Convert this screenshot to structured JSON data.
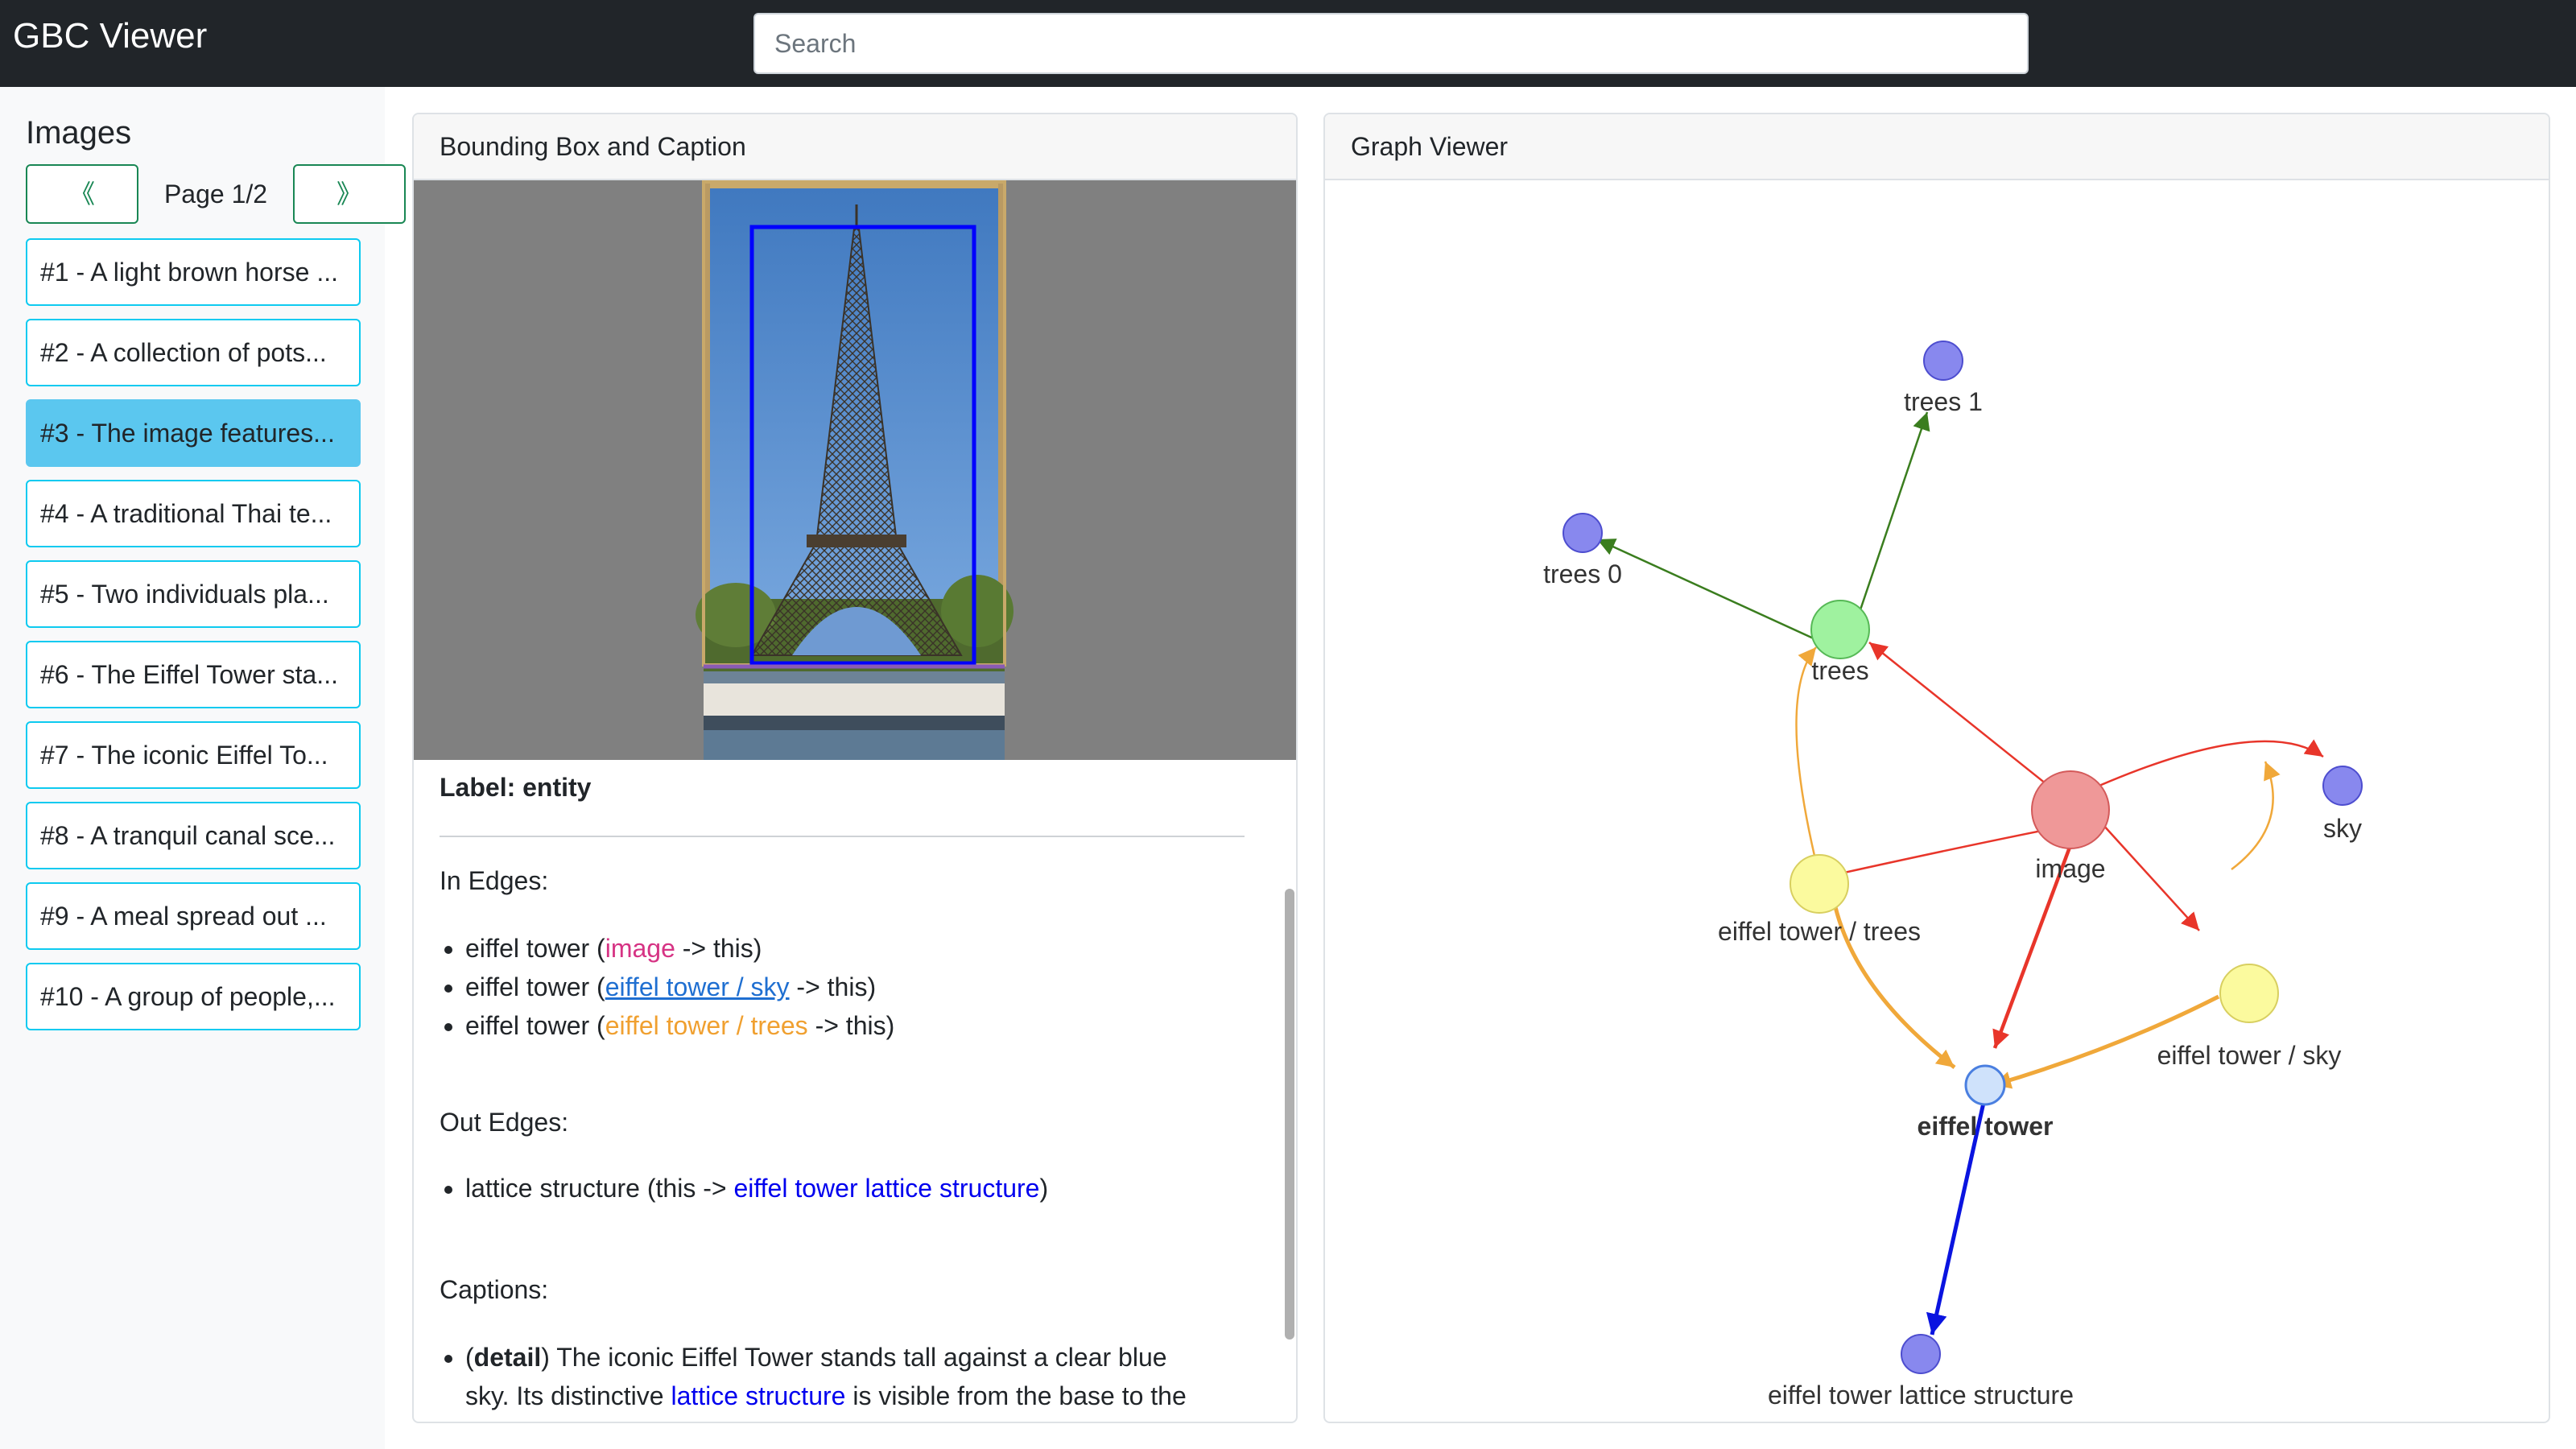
{
  "app": {
    "title": "GBC Viewer"
  },
  "search": {
    "placeholder": "Search"
  },
  "sidebar": {
    "title": "Images",
    "prev_label": "《",
    "next_label": "》",
    "page_text": "Page 1/2",
    "items": [
      {
        "label": "#1 - A light brown horse ...",
        "active": false
      },
      {
        "label": "#2 - A collection of pots...",
        "active": false
      },
      {
        "label": "#3 - The image features...",
        "active": true
      },
      {
        "label": "#4 - A traditional Thai te...",
        "active": false
      },
      {
        "label": "#5 - Two individuals pla...",
        "active": false
      },
      {
        "label": "#6 - The Eiffel Tower sta...",
        "active": false
      },
      {
        "label": "#7 - The iconic Eiffel To...",
        "active": false
      },
      {
        "label": "#8 - A tranquil canal sce...",
        "active": false
      },
      {
        "label": "#9 - A meal spread out ...",
        "active": false
      },
      {
        "label": "#10 - A group of people,...",
        "active": false
      }
    ]
  },
  "bbox_panel": {
    "header": "Bounding Box and Caption",
    "label": "Label: entity",
    "in_edges_title": "In Edges:",
    "in_edges": [
      {
        "prefix": "eiffel tower (",
        "source": "image",
        "suffix": " -> this)"
      },
      {
        "prefix": "eiffel tower (",
        "source": "eiffel tower / sky",
        "suffix": " -> this)"
      },
      {
        "prefix": "eiffel tower (",
        "source": "eiffel tower / trees",
        "suffix": " -> this)"
      }
    ],
    "out_edges_title": "Out Edges:",
    "out_edges": [
      {
        "prefix": "lattice structure (this -> ",
        "target": "eiffel tower lattice structure",
        "suffix": ")"
      }
    ],
    "captions_title": "Captions:",
    "caption": {
      "tag": "detail",
      "line1_text": " The iconic Eiffel Tower stands tall against a clear blue",
      "line2_prefix": "sky. Its distinctive ",
      "line2_link": "lattice structure",
      "line2_suffix": " is visible from the base to the"
    }
  },
  "graph_panel": {
    "header": "Graph Viewer",
    "nodes": {
      "trees_1": "trees 1",
      "trees_0": "trees 0",
      "trees": "trees",
      "image": "image",
      "sky": "sky",
      "eiffel_tower_trees": "eiffel tower / trees",
      "eiffel_tower_sky": "eiffel tower / sky",
      "eiffel_tower": "eiffel tower",
      "lattice": "eiffel tower lattice structure"
    }
  },
  "colors": {
    "accent_info": "#0dcaf0",
    "active_item": "#5bc7ef",
    "pager_green": "#198754",
    "edge_red": "#e8352a",
    "edge_orange": "#f0a83a",
    "edge_green": "#3a7d1e",
    "edge_blue": "#0a14e0",
    "bbox_blue": "#0000ff"
  }
}
